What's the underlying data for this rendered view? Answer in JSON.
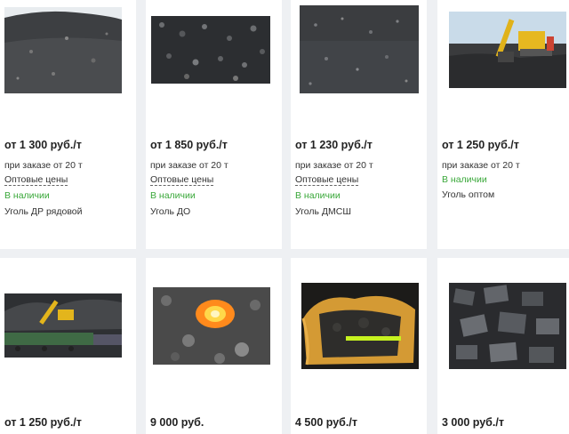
{
  "products": [
    {
      "price": "от 1 300 руб./т",
      "condition": "при заказе от 20 т",
      "wholesale": "Оптовые цены",
      "stock": "В наличии",
      "name": "Уголь ДР рядовой"
    },
    {
      "price": "от 1 850 руб./т",
      "condition": "при заказе от 20 т",
      "wholesale": "Оптовые цены",
      "stock": "В наличии",
      "name": "Уголь ДО"
    },
    {
      "price": "от 1 230 руб./т",
      "condition": "при заказе от 20 т",
      "wholesale": "Оптовые цены",
      "stock": "В наличии",
      "name": "Уголь ДМСШ"
    },
    {
      "price": "от 1 250 руб./т",
      "condition": "при заказе от 20 т",
      "stock": "В наличии",
      "name": "Уголь оптом"
    },
    {
      "price": "от 1 250 руб./т"
    },
    {
      "price": "9 000 руб."
    },
    {
      "price": "4 500 руб./т"
    },
    {
      "price": "3 000 руб./т"
    }
  ]
}
